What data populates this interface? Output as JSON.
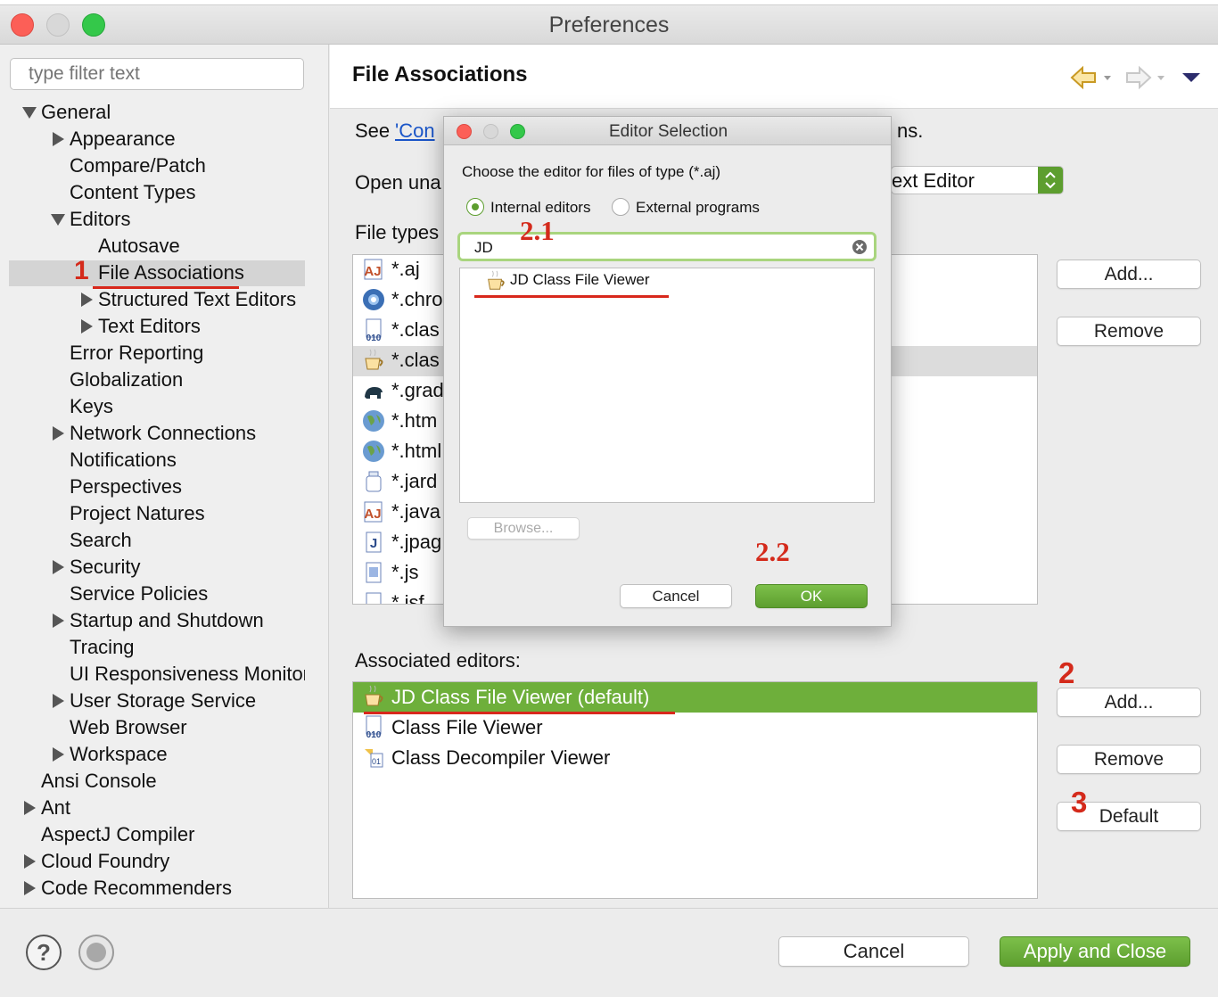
{
  "window": {
    "title": "Preferences"
  },
  "sidebar": {
    "filter_placeholder": "type filter text",
    "items": [
      {
        "label": "General",
        "level": 0,
        "state": "expanded"
      },
      {
        "label": "Appearance",
        "level": 1,
        "state": "collapsed"
      },
      {
        "label": "Compare/Patch",
        "level": 1,
        "state": "leaf"
      },
      {
        "label": "Content Types",
        "level": 1,
        "state": "leaf"
      },
      {
        "label": "Editors",
        "level": 1,
        "state": "expanded"
      },
      {
        "label": "Autosave",
        "level": 2,
        "state": "leaf"
      },
      {
        "label": "File Associations",
        "level": 2,
        "state": "leaf",
        "selected": true
      },
      {
        "label": "Structured Text Editors",
        "level": 2,
        "state": "collapsed"
      },
      {
        "label": "Text Editors",
        "level": 2,
        "state": "collapsed"
      },
      {
        "label": "Error Reporting",
        "level": 1,
        "state": "leaf"
      },
      {
        "label": "Globalization",
        "level": 1,
        "state": "leaf"
      },
      {
        "label": "Keys",
        "level": 1,
        "state": "leaf"
      },
      {
        "label": "Network Connections",
        "level": 1,
        "state": "collapsed"
      },
      {
        "label": "Notifications",
        "level": 1,
        "state": "leaf"
      },
      {
        "label": "Perspectives",
        "level": 1,
        "state": "leaf"
      },
      {
        "label": "Project Natures",
        "level": 1,
        "state": "leaf"
      },
      {
        "label": "Search",
        "level": 1,
        "state": "leaf"
      },
      {
        "label": "Security",
        "level": 1,
        "state": "collapsed"
      },
      {
        "label": "Service Policies",
        "level": 1,
        "state": "leaf"
      },
      {
        "label": "Startup and Shutdown",
        "level": 1,
        "state": "collapsed"
      },
      {
        "label": "Tracing",
        "level": 1,
        "state": "leaf"
      },
      {
        "label": "UI Responsiveness Monitoring",
        "level": 1,
        "state": "leaf"
      },
      {
        "label": "User Storage Service",
        "level": 1,
        "state": "collapsed"
      },
      {
        "label": "Web Browser",
        "level": 1,
        "state": "leaf"
      },
      {
        "label": "Workspace",
        "level": 1,
        "state": "collapsed"
      },
      {
        "label": "Ansi Console",
        "level": 0,
        "state": "leaf"
      },
      {
        "label": "Ant",
        "level": 0,
        "state": "collapsed"
      },
      {
        "label": "AspectJ Compiler",
        "level": 0,
        "state": "leaf"
      },
      {
        "label": "Cloud Foundry",
        "level": 0,
        "state": "collapsed"
      },
      {
        "label": "Code Recommenders",
        "level": 0,
        "state": "collapsed"
      }
    ]
  },
  "page": {
    "title": "File Associations",
    "see_text": "See",
    "see_link": "'Con",
    "see_suffix": "ns.",
    "open_text": "Open una",
    "open_select_value": "ext Editor",
    "file_types_label": "File types",
    "file_types": [
      {
        "label": "*.aj",
        "icon": "aspectj-file-icon"
      },
      {
        "label": "*.chro",
        "icon": "chrome-icon"
      },
      {
        "label": "*.clas",
        "icon": "binary-class-icon"
      },
      {
        "label": "*.clas",
        "icon": "coffee-cup-icon",
        "selected": true
      },
      {
        "label": "*.grad",
        "icon": "gradle-elephant-icon"
      },
      {
        "label": "*.htm",
        "icon": "globe-icon"
      },
      {
        "label": "*.html",
        "icon": "globe-icon"
      },
      {
        "label": "*.jard",
        "icon": "jar-icon"
      },
      {
        "label": "*.java",
        "icon": "aspectj-file-icon"
      },
      {
        "label": "*.jpag",
        "icon": "java-page-icon"
      },
      {
        "label": "*.js",
        "icon": "js-file-icon"
      },
      {
        "label": "*.jsf",
        "icon": "file-icon"
      }
    ],
    "file_type_buttons": {
      "add": "Add...",
      "remove": "Remove"
    },
    "associated_label": "Associated editors:",
    "associated_editors": [
      {
        "label": "JD Class File Viewer (default)",
        "icon": "coffee-cup-icon",
        "selected": true
      },
      {
        "label": "Class File Viewer",
        "icon": "binary-class-icon"
      },
      {
        "label": "Class Decompiler Viewer",
        "icon": "decompiler-icon"
      }
    ],
    "editor_buttons": {
      "add": "Add...",
      "remove": "Remove",
      "default": "Default"
    }
  },
  "footer": {
    "cancel": "Cancel",
    "apply_close": "Apply and Close"
  },
  "dialog": {
    "title": "Editor Selection",
    "prompt": "Choose the editor for files of type (*.aj)",
    "radio_internal": "Internal editors",
    "radio_external": "External programs",
    "search_value": "JD",
    "results": [
      {
        "label": "JD Class File Viewer",
        "icon": "coffee-cup-icon"
      }
    ],
    "browse": "Browse...",
    "cancel": "Cancel",
    "ok": "OK"
  },
  "annotations": {
    "a1": "1",
    "a2": "2",
    "a21": "2.1",
    "a22": "2.2",
    "a3": "3"
  },
  "colors": {
    "accent_green": "#6eaf3b",
    "annotation_red": "#d8281c",
    "selection_gray": "#d4d4d4"
  }
}
